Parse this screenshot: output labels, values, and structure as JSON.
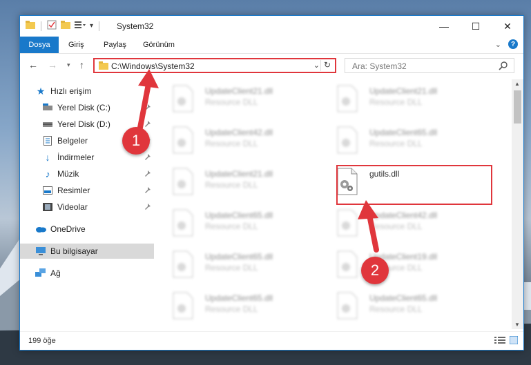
{
  "window": {
    "title": "System32"
  },
  "titlebar": {
    "minimize": "—",
    "maximize": "☐",
    "close": "✕"
  },
  "ribbon": {
    "tabs": [
      "Dosya",
      "Giriş",
      "Paylaş",
      "Görünüm"
    ],
    "help": "?"
  },
  "address": {
    "path": "C:\\Windows\\System32",
    "search_placeholder": "Ara: System32"
  },
  "sidebar": {
    "items": [
      {
        "label": "Hızlı erişim"
      },
      {
        "label": "Yerel Disk (C:)"
      },
      {
        "label": "Yerel Disk (D:)"
      },
      {
        "label": "Belgeler"
      },
      {
        "label": "İndirmeler"
      },
      {
        "label": "Müzik"
      },
      {
        "label": "Resimler"
      },
      {
        "label": "Videolar"
      },
      {
        "label": "OneDrive"
      },
      {
        "label": "Bu bilgisayar"
      },
      {
        "label": "Ağ"
      }
    ]
  },
  "files": [
    {
      "name": "UpdateClient21.dll",
      "desc": "Resource DLL"
    },
    {
      "name": "UpdateClient21.dll",
      "desc": "Resource DLL"
    },
    {
      "name": "UpdateClient42.dll",
      "desc": "Resource DLL"
    },
    {
      "name": "UpdateClient65.dll",
      "desc": "Resource DLL"
    },
    {
      "name": "UpdateClient21.dll",
      "desc": "Resource DLL"
    },
    {
      "name": "gutils.dll",
      "desc": ""
    },
    {
      "name": "UpdateClient65.dll",
      "desc": "Resource DLL"
    },
    {
      "name": "UpdateClient42.dll",
      "desc": "Resource DLL"
    },
    {
      "name": "UpdateClient65.dll",
      "desc": "Resource DLL"
    },
    {
      "name": "UpdateClient19.dll",
      "desc": "Resource DLL"
    },
    {
      "name": "UpdateClient65.dll",
      "desc": "Resource DLL"
    },
    {
      "name": "UpdateClient65.dll",
      "desc": "Resource DLL"
    }
  ],
  "status": {
    "count": "199 öğe"
  },
  "annotations": {
    "step1": "1",
    "step2": "2"
  },
  "colors": {
    "accent": "#1979ca",
    "highlight": "#e0363c"
  }
}
